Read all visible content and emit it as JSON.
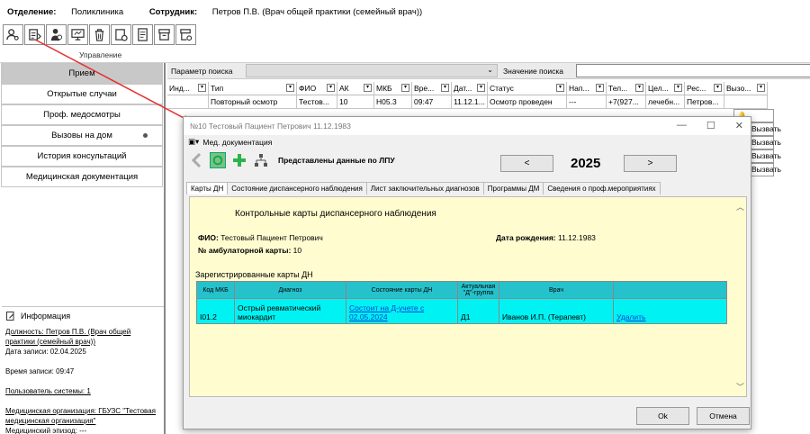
{
  "header": {
    "department_label": "Отделение:",
    "department_value": "Поликлиника",
    "employee_label": "Сотрудник:",
    "employee_value": "Петров П.В. (Врач общей практики (семейный врач))"
  },
  "toolbar": {
    "group_label": "Управление"
  },
  "sidebar": {
    "items": [
      {
        "label": "Прием"
      },
      {
        "label": "Открытые случаи"
      },
      {
        "label": "Проф. медосмотры"
      },
      {
        "label": "Вызовы на дом"
      },
      {
        "label": "История консультаций"
      },
      {
        "label": "Медицинская документация"
      }
    ],
    "info_title": "Информация",
    "info": {
      "position": "Должность: Петров П.В. (Врач общей практики (семейный врач))",
      "record_date": "Дата записи: 02.04.2025",
      "record_time": "Время записи: 09:47",
      "system_user": "Пользователь системы: 1",
      "org": "Медицинская организация: ГБУЗС \"Тестовая медицинская организация\"",
      "episode": "Медицинский эпизод: ---"
    }
  },
  "search": {
    "param_label": "Параметр поиска",
    "value_label": "Значение поиска"
  },
  "grid": {
    "columns": [
      "Инд...",
      "Тип",
      "ФИО",
      "АК",
      "МКБ",
      "Вре...",
      "Дат...",
      "Статус",
      "Нап...",
      "Тел...",
      "Цел...",
      "Рес...",
      "Вызо..."
    ],
    "row": [
      "",
      "Повторный осмотр",
      "Тестов...",
      "10",
      "H05.3",
      "09:47",
      "11.12.1...",
      "Осмотр проведен",
      "---",
      "+7(927...",
      "лечебн...",
      "Петров...",
      ""
    ],
    "call_label": "Вызвать"
  },
  "dialog": {
    "title": "№10 Тестовый Пациент Петрович 11.12.1983",
    "menu": "Мед. документация",
    "data_source": "Представлены данные по ЛПУ",
    "prev": "<",
    "next": ">",
    "year": "2025",
    "tabs": [
      "Карты ДН",
      "Состояние диспансерного наблюдения",
      "Лист заключительных диагнозов",
      "Программы ДМ",
      "Сведения о проф.мероприятиях"
    ],
    "heading": "Контрольные карты диспансерного наблюдения",
    "fio_label": "ФИО:",
    "fio_value": "Тестовый Пациент Петрович",
    "dob_label": "Дата рождения:",
    "dob_value": "11.12.1983",
    "card_label": "№ амбулаторной карты:",
    "card_value": "10",
    "registered": "Зарегистрированные карты ДН",
    "table_headers": [
      "Код МКБ",
      "Диагноз",
      "Состояние карты ДН",
      "Актуальная \"Д\"-группа",
      "Врач",
      ""
    ],
    "table_row": {
      "code": "I01.2",
      "diagnosis": "Острый ревматический миокардит",
      "state": "Состоит на Д-учете с 02.05.2024",
      "group": "Д1",
      "doctor": "Иванов И.П. (Терапевт)",
      "action": "Удалить"
    },
    "ok": "Ok",
    "cancel": "Отмена"
  }
}
